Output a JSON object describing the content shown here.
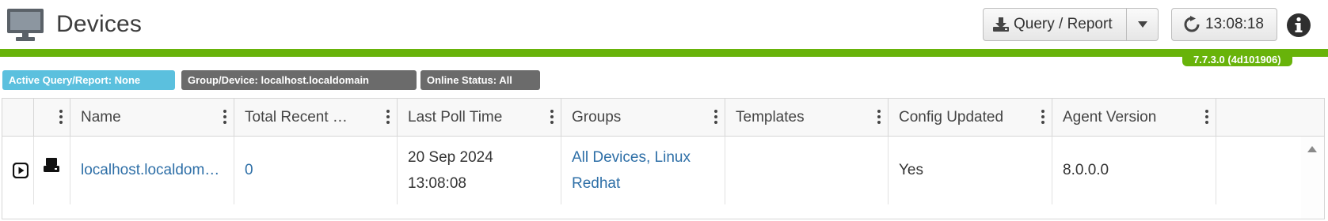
{
  "header": {
    "title": "Devices",
    "query_button_label": "Query / Report",
    "refresh_time": "13:08:18",
    "version": "7.7.3.0 (4d101906)"
  },
  "filters": {
    "active_query": "Active Query/Report: None",
    "group_device": "Group/Device: localhost.localdomain",
    "online_status": "Online Status: All"
  },
  "table": {
    "columns": [
      "Name",
      "Total Recent …",
      "Last Poll Time",
      "Groups",
      "Templates",
      "Config Updated",
      "Agent Version"
    ],
    "rows": [
      {
        "name": "localhost.localdom…",
        "total_recent": "0",
        "last_poll_date": "20 Sep 2024",
        "last_poll_time": "13:08:08",
        "groups_line1": "All Devices, Linux",
        "groups_line2": "Redhat",
        "templates": "",
        "config_updated": "Yes",
        "agent_version": "8.0.0.0"
      }
    ]
  },
  "colors": {
    "accent_green": "#68b30a",
    "badge_blue": "#5bc0de",
    "badge_gray": "#6b6b6b",
    "link_blue": "#2e6fa7"
  },
  "icons": [
    "monitor-icon",
    "download-icon",
    "caret-down-icon",
    "refresh-icon",
    "info-icon",
    "kebab-icon",
    "expand-play-icon",
    "device-icon",
    "scroll-up-icon"
  ]
}
